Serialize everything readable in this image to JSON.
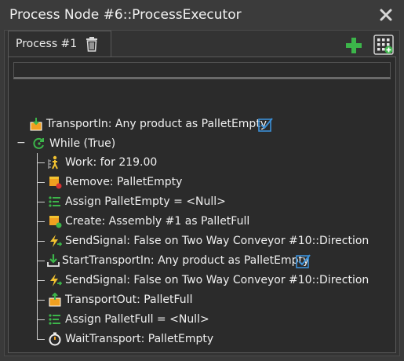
{
  "window": {
    "title": "Process Node #6::ProcessExecutor",
    "close_icon": "close-icon"
  },
  "tab": {
    "label": "Process #1",
    "delete_icon": "trash-icon"
  },
  "toolbar": {
    "add_icon": "plus-icon",
    "grid_icon": "grid-add-icon"
  },
  "tree": {
    "root": {
      "label": "TransportIn: Any product as PalletEmpty",
      "icon": "transport-in-icon",
      "checked": true
    },
    "loop": {
      "toggle": "−",
      "label": "While (True)",
      "icon": "loop-icon"
    },
    "children": [
      {
        "label": "Work: for 219.00",
        "icon": "worker-icon"
      },
      {
        "label": "Remove: PalletEmpty",
        "icon": "remove-box-icon"
      },
      {
        "label": "Assign PalletEmpty = <Null>",
        "icon": "assign-icon"
      },
      {
        "label": "Create: Assembly #1 as PalletFull",
        "icon": "create-box-icon"
      },
      {
        "label": "SendSignal: False on Two Way Conveyor #10::Direction",
        "icon": "signal-icon"
      },
      {
        "label": "StartTransportIn: Any product as PalletEmpty",
        "icon": "start-transport-in-icon",
        "checked": true
      },
      {
        "label": "SendSignal: False on Two Way Conveyor #10::Direction",
        "icon": "signal-icon"
      },
      {
        "label": "TransportOut: PalletFull",
        "icon": "transport-out-icon"
      },
      {
        "label": "Assign PalletFull = <Null>",
        "icon": "assign-icon"
      },
      {
        "label": "WaitTransport: PalletEmpty",
        "icon": "stopwatch-icon"
      }
    ]
  },
  "colors": {
    "accent_green": "#3cb54a",
    "accent_blue": "#3b8fd6",
    "orange": "#f0a020",
    "yellow": "#f2c230"
  }
}
